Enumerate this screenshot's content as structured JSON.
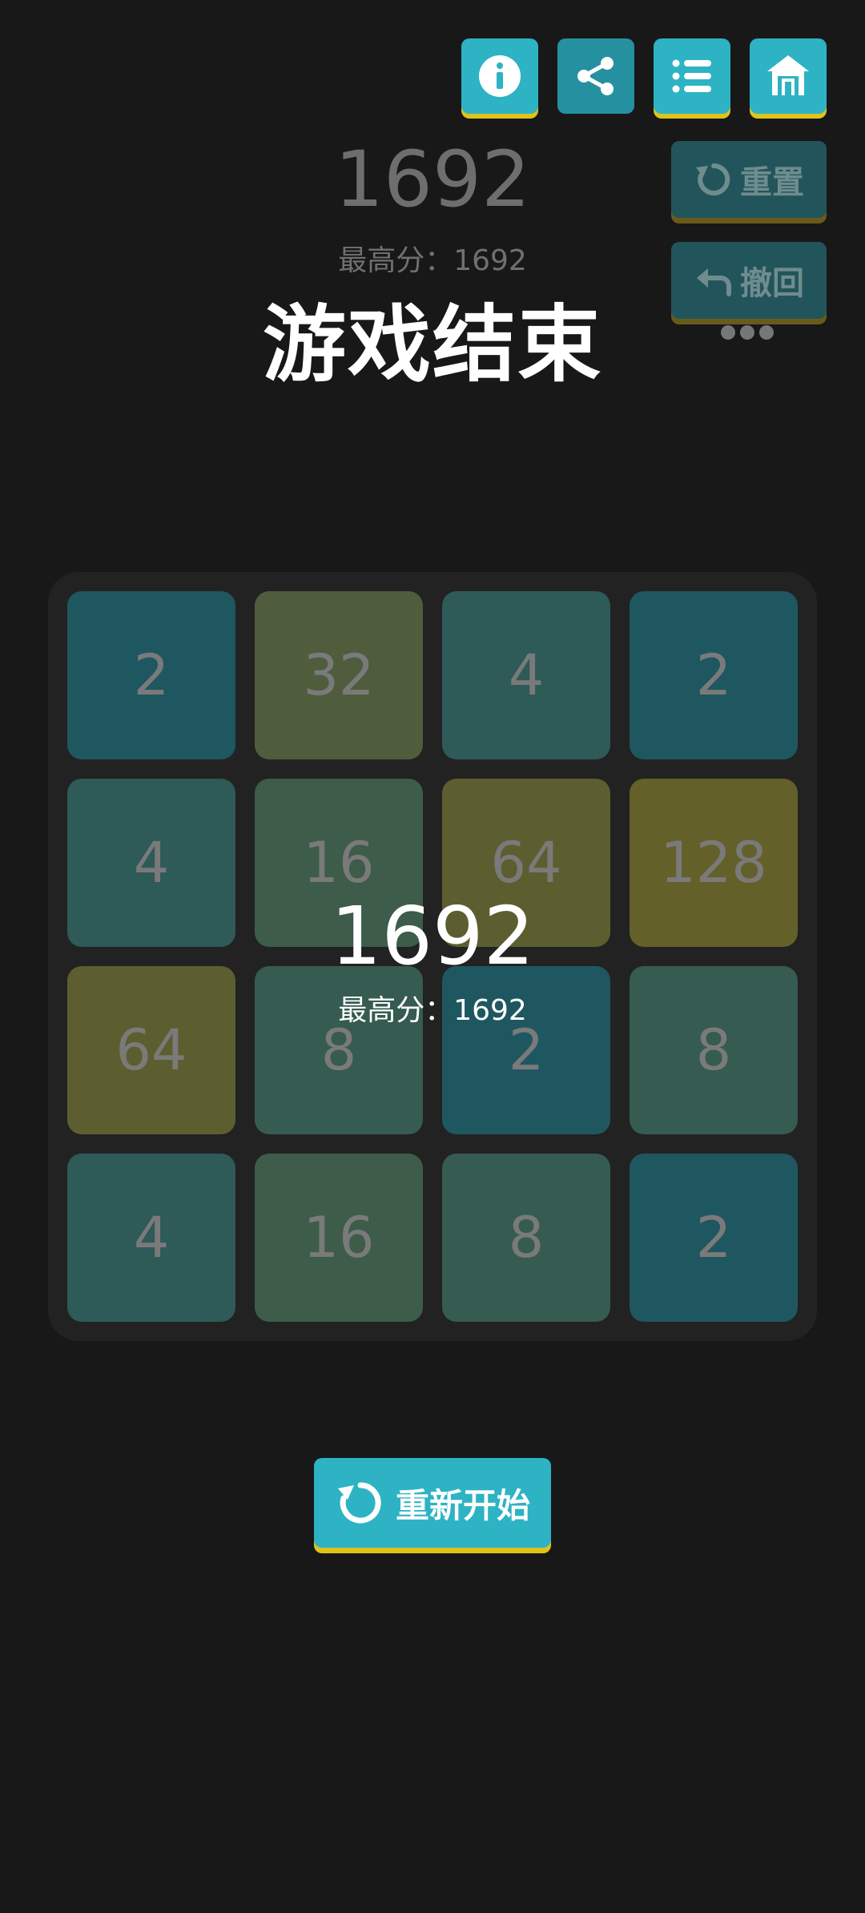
{
  "top_buttons": {
    "info_icon": "info-icon",
    "share_icon": "share-icon",
    "list_icon": "list-icon",
    "home_icon": "home-icon"
  },
  "header": {
    "score": "1692",
    "best_label": "最高分：1692",
    "status": "游戏结束"
  },
  "side_buttons": {
    "reset_label": "重置",
    "undo_label": "撤回"
  },
  "board": {
    "tiles": [
      {
        "value": "2",
        "color": "#1f5760"
      },
      {
        "value": "32",
        "color": "#4f5d3d"
      },
      {
        "value": "4",
        "color": "#2e5a58"
      },
      {
        "value": "2",
        "color": "#1f5760"
      },
      {
        "value": "4",
        "color": "#2e5a58"
      },
      {
        "value": "16",
        "color": "#3d5c4a"
      },
      {
        "value": "64",
        "color": "#5c5e30"
      },
      {
        "value": "128",
        "color": "#646029"
      },
      {
        "value": "64",
        "color": "#5c5e30"
      },
      {
        "value": "8",
        "color": "#365b50"
      },
      {
        "value": "2",
        "color": "#1f5760"
      },
      {
        "value": "8",
        "color": "#365b50"
      },
      {
        "value": "4",
        "color": "#2e5a58"
      },
      {
        "value": "16",
        "color": "#3d5c4a"
      },
      {
        "value": "8",
        "color": "#365b50"
      },
      {
        "value": "2",
        "color": "#1f5760"
      }
    ]
  },
  "overlay": {
    "score": "1692",
    "best_label": "最高分：1692"
  },
  "restart": {
    "label": "重新开始"
  },
  "colors": {
    "accent": "#2db3c4",
    "accent_shadow": "#e0c21c",
    "background": "#181818"
  }
}
